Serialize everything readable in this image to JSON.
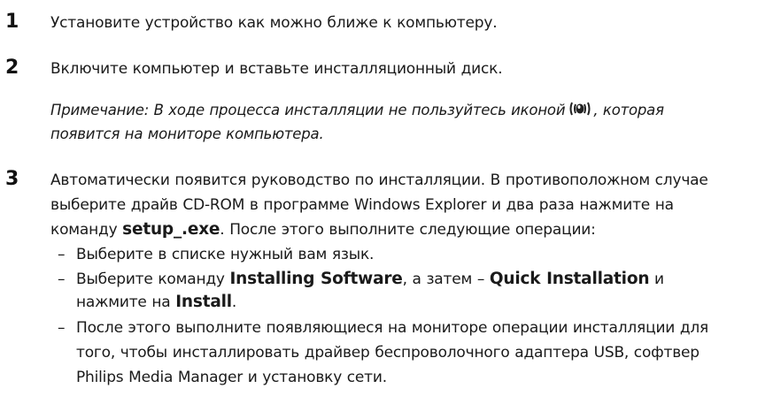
{
  "steps": [
    {
      "number": "1",
      "text": "Установите устройство как можно ближе к компьютеру."
    },
    {
      "number": "2",
      "text": "Включите компьютер и вставьте инсталляционный диск.",
      "note": {
        "before_icon": "Примечание: В ходе процесса инсталляции не пользуйтесь иконой",
        "icon": "wireless-monitor-icon",
        "after_icon": ", которая",
        "line2": "появится на мониторе компьютера."
      }
    },
    {
      "number": "3",
      "line1": "Автоматически появится руководство по инсталляции. В противоположном случае",
      "line2": "выберите драйв CD-ROM в программе Windows Explorer и два раза нажмите на",
      "line3_pre": "команду ",
      "line3_bold": "setup_.exe",
      "line3_post": ". После этого выполните следующие операции:",
      "bullets": [
        {
          "dash": "–",
          "text": "Выберите в списке нужный вам язык."
        },
        {
          "dash": "–",
          "pre": "Выберите команду ",
          "bold1": "Installing Software",
          "mid": ", а затем – ",
          "bold2": "Quick Installation",
          "post": " и",
          "line2_pre": "нажмите на ",
          "line2_bold": "Install",
          "line2_post": "."
        },
        {
          "dash": "–",
          "line1": "После этого выполните появляющиеся на мониторе операции инсталляции для",
          "line2": "того, чтобы инсталлировать драйвер беспроволочного адаптера USB, софтвер",
          "line3": "Philips Media Manager и установку сети."
        }
      ]
    }
  ]
}
